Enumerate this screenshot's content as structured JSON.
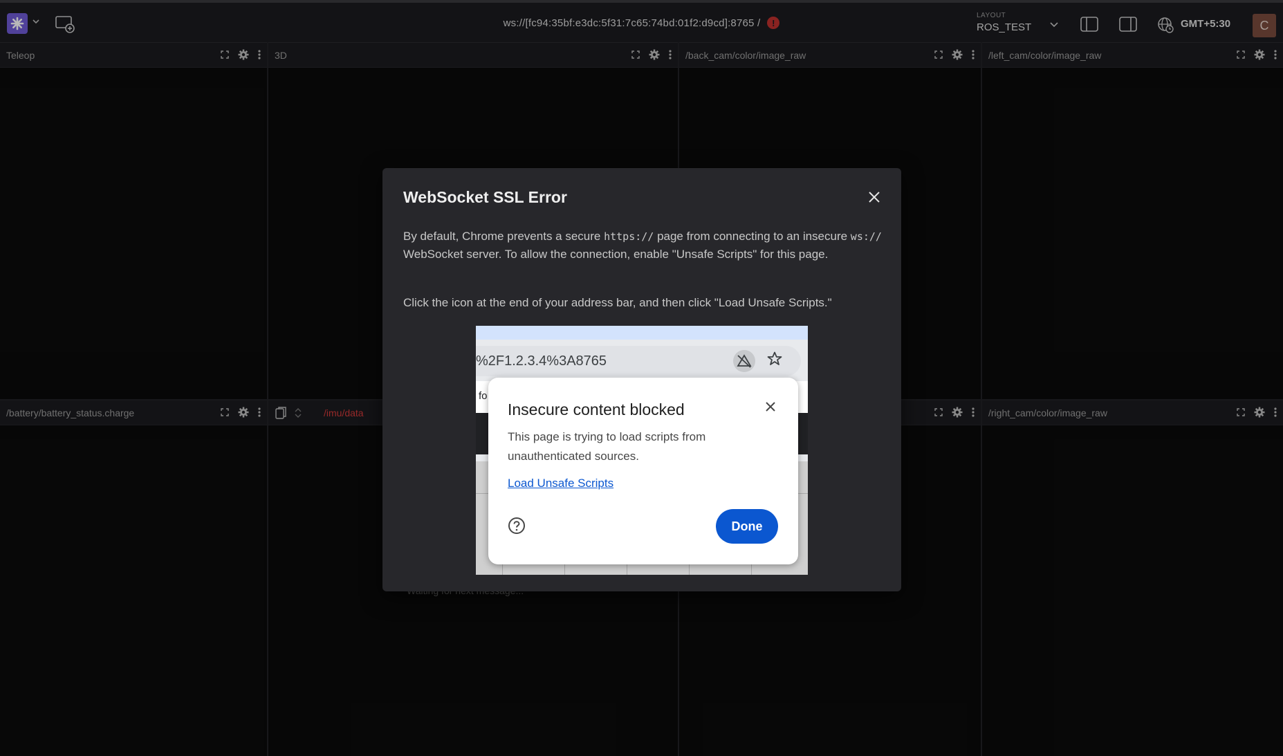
{
  "topbar": {
    "connection_url": "ws://[fc94:35bf:e3dc:5f31:7c65:74bd:01f2:d9cd]:8765 /",
    "connection_alert": "!",
    "layout_label": "LAYOUT",
    "layout_value": "ROS_TEST",
    "timezone": "GMT+5:30",
    "avatar_initial": "C",
    "icons": [
      "app-logo-icon",
      "chevron-down-icon",
      "add-panel-icon",
      "left-sidebar-toggle-icon",
      "right-sidebar-toggle-icon",
      "globe-clock-icon"
    ]
  },
  "panels": {
    "teleop": "Teleop",
    "threed": "3D",
    "back_cam": "/back_cam/color/image_raw",
    "left_cam": "/left_cam/color/image_raw",
    "battery": "/battery/battery_status.charge",
    "imu": "/imu/data",
    "right_cam": "/right_cam/color/image_raw",
    "imu_waiting": "Waiting for next message..."
  },
  "modal": {
    "title": "WebSocket SSL Error",
    "p1_a": "By default, Chrome prevents a secure ",
    "p1_code1": "https://",
    "p1_b": " page from connecting to an insecure ",
    "p1_code2": "ws://",
    "p1_c": " WebSocket server. To allow the connection, enable \"Unsafe Scripts\" for this page.",
    "p2": "Click the icon at the end of your address bar, and then click \"Load Unsafe Scripts.\""
  },
  "illustration": {
    "url_text": "%2F1.2.3.4%3A8765",
    "partial_text": "fo",
    "popup_title": "Insecure content blocked",
    "popup_body": "This page is trying to load scripts from unauthenticated sources.",
    "popup_link": "Load Unsafe Scripts",
    "popup_done": "Done"
  },
  "colors": {
    "accent": "#6f5ad6",
    "error": "#d23a3a",
    "chrome_blue": "#0b57d0"
  }
}
